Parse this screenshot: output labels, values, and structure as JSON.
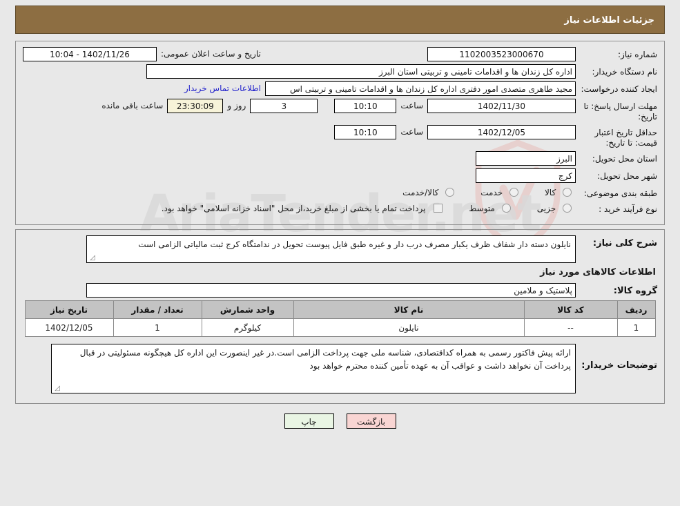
{
  "header": {
    "title": "جزئیات اطلاعات نیاز",
    "bg": "#8d6e42"
  },
  "info": {
    "need_number_label": "شماره نیاز:",
    "need_number": "1102003523000670",
    "announce_label": "تاریخ و ساعت اعلان عمومی:",
    "announce_value": "1402/11/26 - 10:04",
    "buyer_org_label": "نام دستگاه خریدار:",
    "buyer_org": "اداره کل زندان ها و اقدامات تامینی و تربیتی استان البرز",
    "requester_label": "ایجاد کننده درخواست:",
    "requester": "مجید طاهری متصدی امور دفتری اداره کل زندان ها و اقدامات تامینی و تربیتی اس",
    "contact_link": "اطلاعات تماس خریدار",
    "deadline_label": "مهلت ارسال پاسخ: تا تاریخ:",
    "deadline_date": "1402/11/30",
    "hour_label": "ساعت",
    "deadline_time": "10:10",
    "days_remaining": "3",
    "days_word": "روز و",
    "time_remaining": "23:30:09",
    "remaining_suffix": "ساعت باقی مانده",
    "validity_label": "حداقل تاریخ اعتبار قیمت: تا تاریخ:",
    "validity_date": "1402/12/05",
    "validity_time": "10:10",
    "province_label": "استان محل تحویل:",
    "province": "البرز",
    "city_label": "شهر محل تحویل:",
    "city": "کرج",
    "category_label": "طبقه بندی موضوعی:",
    "category_options": [
      "کالا",
      "خدمت",
      "کالا/خدمت"
    ],
    "category_selected": "کالا",
    "process_label": "نوع فرآیند خرید :",
    "process_options": [
      "جزیی",
      "متوسط"
    ],
    "process_selected": "جزیی",
    "treasury_note": "پرداخت تمام یا بخشی از مبلغ خرید،از محل \"اسناد خزانه اسلامی\" خواهد بود."
  },
  "need": {
    "summary_label": "شرح کلی نیاز:",
    "summary_text": "نایلون دسته دار شفاف    ظرف یکبار مصرف درب دار و غیره طبق فایل پیوست تحویل در ندامتگاه کرج ثبت مالیاتی الزامی است",
    "goods_section_title": "اطلاعات کالاهای مورد نیاز",
    "group_label": "گروه کالا:",
    "group_value": "پلاستیک و ملامین"
  },
  "table": {
    "columns": [
      "ردیف",
      "کد کالا",
      "نام کالا",
      "واحد شمارش",
      "تعداد / مقدار",
      "تاریخ نیاز"
    ],
    "rows": [
      {
        "index": "1",
        "code": "--",
        "name": "نایلون",
        "unit": "کیلوگرم",
        "qty": "1",
        "date": "1402/12/05"
      }
    ]
  },
  "buyer_notes": {
    "label": "توضیحات خریدار:",
    "text": "ارائه پیش فاکتور رسمی به همراه کداقتصادی، شناسه ملی جهت پرداخت الزامی است.در غیر اینصورت این اداره کل هیچگونه مسئولیتی در قبال پرداخت آن نخواهد داشت و عواقب آن به عهده تأمین کننده محترم خواهد بود"
  },
  "footer": {
    "print_label": "چاپ",
    "back_label": "بازگشت"
  },
  "watermark": {
    "text": "AriaTender.net"
  }
}
